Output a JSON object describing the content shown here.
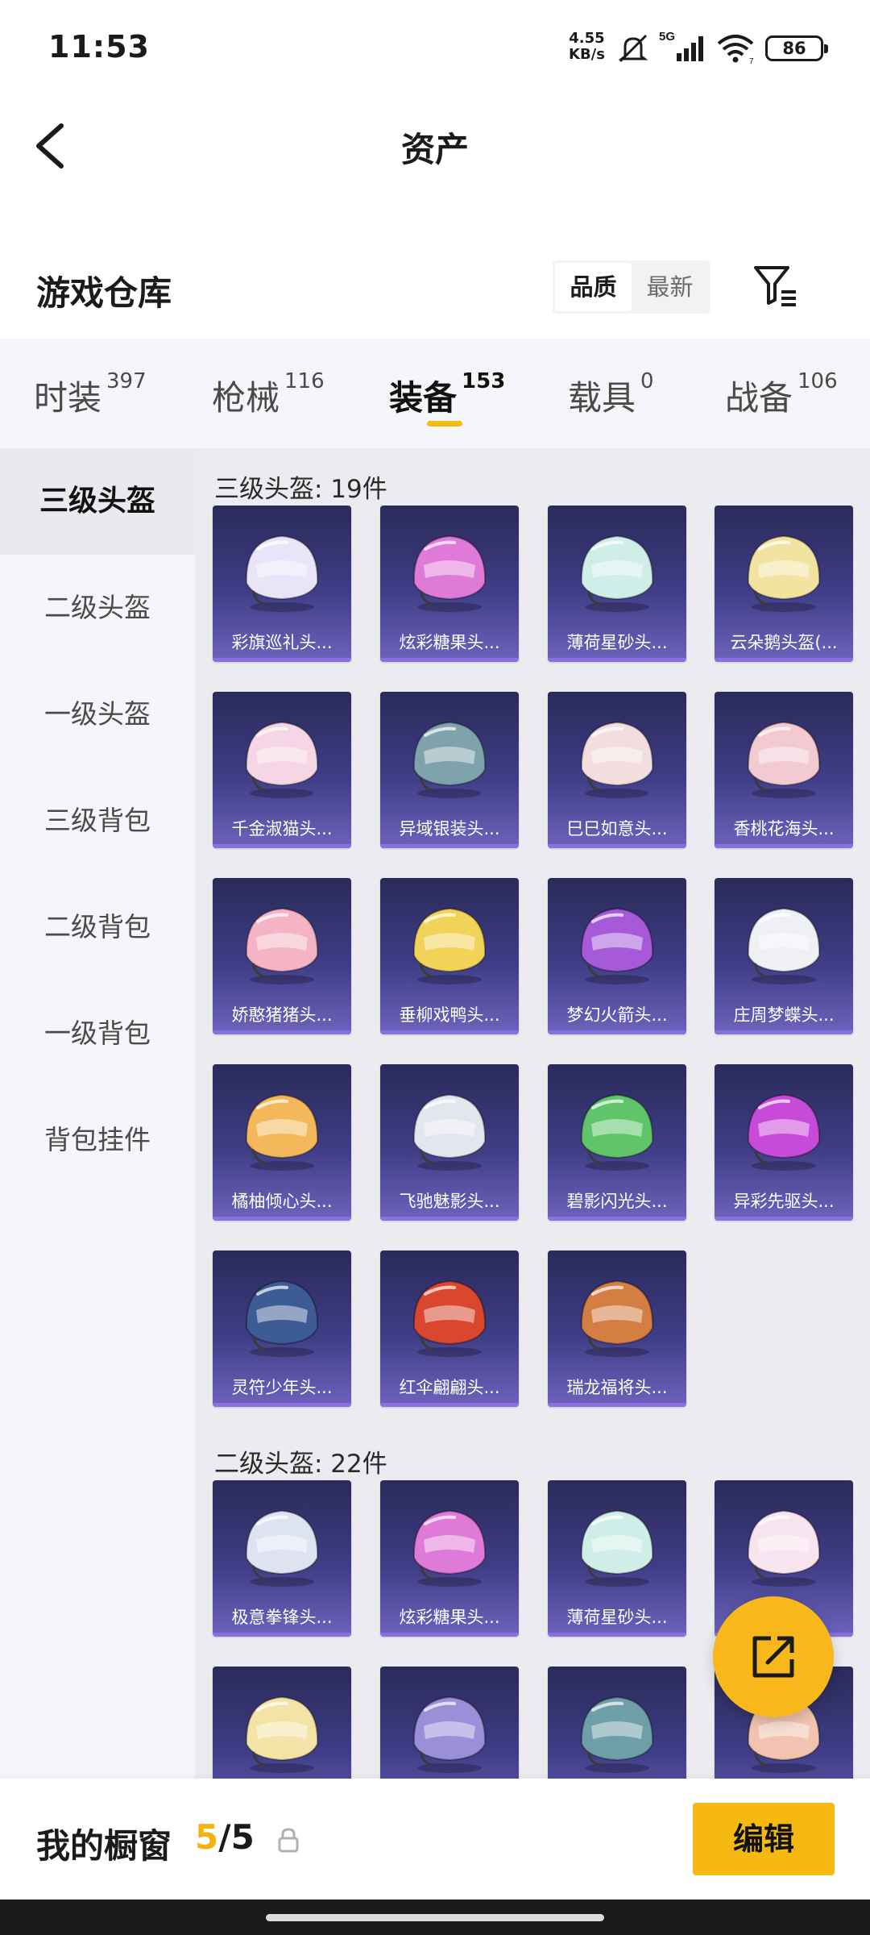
{
  "status_bar": {
    "time": "11:53",
    "net_speed_value": "4.55",
    "net_speed_unit": "KB/s",
    "network": "5G",
    "wifi_level": "7",
    "battery": "86"
  },
  "header": {
    "title": "资产"
  },
  "warehouse": {
    "title": "游戏仓库",
    "sort_options": [
      "品质",
      "最新"
    ],
    "sort_selected": "品质"
  },
  "tabs": [
    {
      "label": "时装",
      "count": "397"
    },
    {
      "label": "枪械",
      "count": "116"
    },
    {
      "label": "装备",
      "count": "153"
    },
    {
      "label": "载具",
      "count": "0"
    },
    {
      "label": "战备",
      "count": "106"
    }
  ],
  "active_tab": "装备",
  "sidebar": [
    {
      "label": "三级头盔"
    },
    {
      "label": "二级头盔"
    },
    {
      "label": "一级头盔"
    },
    {
      "label": "三级背包"
    },
    {
      "label": "二级背包"
    },
    {
      "label": "一级背包"
    },
    {
      "label": "背包挂件"
    }
  ],
  "sections": [
    {
      "title": "三级头盔: 19件",
      "items": [
        {
          "name": "彩旗巡礼头...",
          "color": "#e9e4f7"
        },
        {
          "name": "炫彩糖果头...",
          "color": "#e07ad8"
        },
        {
          "name": "薄荷星砂头...",
          "color": "#cfeee8"
        },
        {
          "name": "云朵鹅头盔(...",
          "color": "#f3e3a0"
        },
        {
          "name": "千金淑猫头...",
          "color": "#f6d6e4"
        },
        {
          "name": "异域银装头...",
          "color": "#7fa3ad"
        },
        {
          "name": "巳巳如意头...",
          "color": "#f2dede"
        },
        {
          "name": "香桃花海头...",
          "color": "#f3c9d2"
        },
        {
          "name": "娇憨猪猪头...",
          "color": "#f5b3c6"
        },
        {
          "name": "垂柳戏鸭头...",
          "color": "#f2d35a"
        },
        {
          "name": "梦幻火箭头...",
          "color": "#a65ad9"
        },
        {
          "name": "庄周梦蝶头...",
          "color": "#eef0f4"
        },
        {
          "name": "橘柚倾心头...",
          "color": "#f2b85a"
        },
        {
          "name": "飞驰魅影头...",
          "color": "#e4e6ee"
        },
        {
          "name": "碧影闪光头...",
          "color": "#5fc46a"
        },
        {
          "name": "异彩先驱头...",
          "color": "#c84ad8"
        },
        {
          "name": "灵符少年头...",
          "color": "#3d5c96"
        },
        {
          "name": "红伞翩翩头...",
          "color": "#d9472f"
        },
        {
          "name": "瑞龙福将头...",
          "color": "#d47e44"
        }
      ]
    },
    {
      "title": "二级头盔: 22件",
      "items": [
        {
          "name": "极意拳锋头...",
          "color": "#dde3f0"
        },
        {
          "name": "炫彩糖果头...",
          "color": "#e07ad8"
        },
        {
          "name": "薄荷星砂头...",
          "color": "#cfeee8"
        },
        {
          "name": "",
          "color": "#f7e4ee"
        },
        {
          "name": "",
          "color": "#f4e3a6"
        },
        {
          "name": "",
          "color": "#9a8fd8"
        },
        {
          "name": "",
          "color": "#6e9ea8"
        },
        {
          "name": "",
          "color": "#f1c3b0"
        }
      ]
    }
  ],
  "showcase": {
    "label": "我的橱窗",
    "current": "5",
    "total": "/5",
    "edit_label": "编辑"
  }
}
